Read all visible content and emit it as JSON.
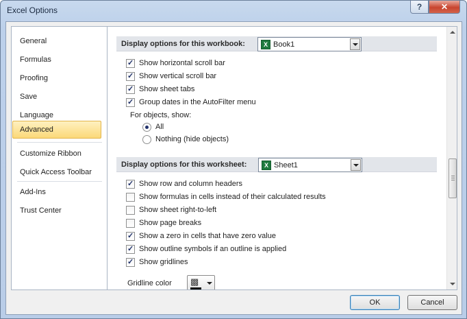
{
  "window": {
    "title": "Excel Options",
    "help_label": "?",
    "close_label": "✕"
  },
  "nav": {
    "items": [
      {
        "label": "General"
      },
      {
        "label": "Formulas"
      },
      {
        "label": "Proofing"
      },
      {
        "label": "Save"
      },
      {
        "label": "Language"
      },
      {
        "label": "Advanced",
        "selected": true
      },
      {
        "label": "Customize Ribbon"
      },
      {
        "label": "Quick Access Toolbar"
      },
      {
        "label": "Add-Ins"
      },
      {
        "label": "Trust Center"
      }
    ]
  },
  "workbook_section": {
    "label": "Display options for this workbook:",
    "selected_workbook": "Book1",
    "options": [
      {
        "label": "Show horizontal scroll bar",
        "checked": true
      },
      {
        "label": "Show vertical scroll bar",
        "checked": true
      },
      {
        "label": "Show sheet tabs",
        "checked": true
      },
      {
        "label": "Group dates in the AutoFilter menu",
        "checked": true
      }
    ],
    "objects_label": "For objects, show:",
    "object_choices": [
      {
        "label": "All",
        "selected": true
      },
      {
        "label": "Nothing (hide objects)",
        "selected": false
      }
    ]
  },
  "worksheet_section": {
    "label": "Display options for this worksheet:",
    "selected_sheet": "Sheet1",
    "options": [
      {
        "label": "Show row and column headers",
        "checked": true
      },
      {
        "label": "Show formulas in cells instead of their calculated results",
        "checked": false
      },
      {
        "label": "Show sheet right-to-left",
        "checked": false
      },
      {
        "label": "Show page breaks",
        "checked": false
      },
      {
        "label": "Show a zero in cells that have zero value",
        "checked": true
      },
      {
        "label": "Show outline symbols if an outline is applied",
        "checked": true
      },
      {
        "label": "Show gridlines",
        "checked": true
      }
    ],
    "gridline_color_label": "Gridline color"
  },
  "buttons": {
    "ok": "OK",
    "cancel": "Cancel"
  },
  "icons": {
    "excel_file": "excel-file-icon",
    "paint_bucket": "paint-bucket-icon"
  },
  "colors": {
    "selected_nav_bg": "#fbd979",
    "check_mark": "#21326b",
    "close_red": "#c8452f"
  }
}
